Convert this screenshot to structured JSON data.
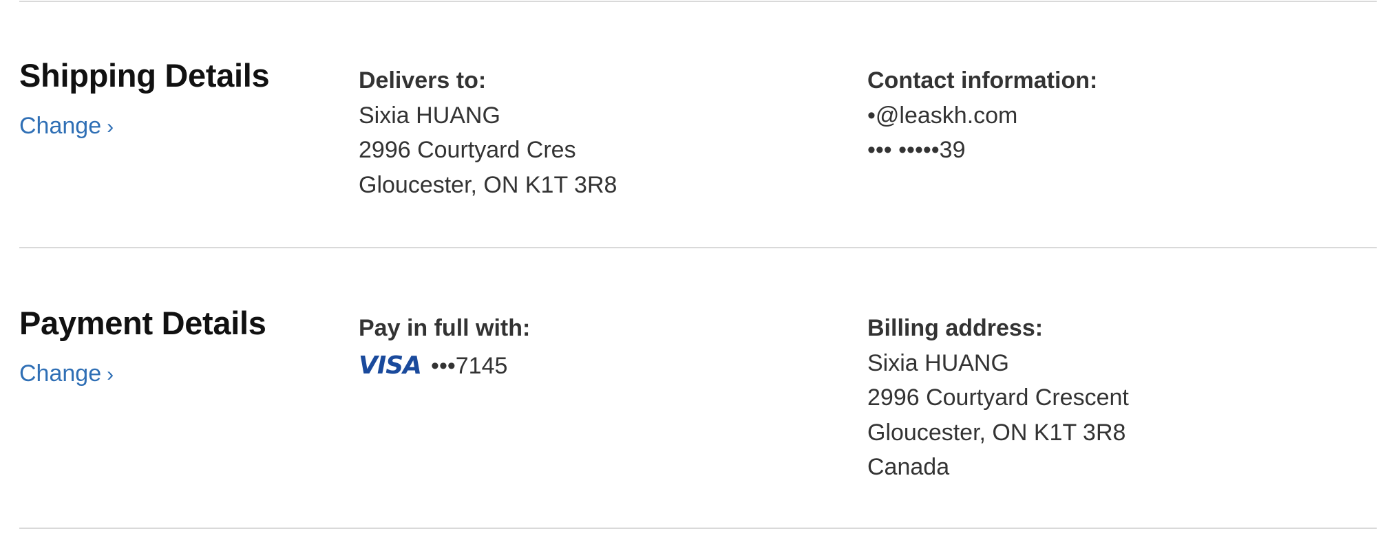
{
  "shipping": {
    "title": "Shipping Details",
    "change_label": "Change",
    "delivers_to": {
      "heading": "Delivers to:",
      "lines": [
        "Sixia HUANG",
        "2996 Courtyard Cres",
        "Gloucester, ON K1T 3R8"
      ]
    },
    "contact": {
      "heading": "Contact information:",
      "lines": [
        "•@leaskh.com",
        "••• •••••39"
      ]
    }
  },
  "payment": {
    "title": "Payment Details",
    "change_label": "Change",
    "pay_with": {
      "heading": "Pay in full with:",
      "card_brand": "VISA",
      "card_number": "•••7145"
    },
    "billing": {
      "heading": "Billing address:",
      "lines": [
        "Sixia HUANG",
        "2996 Courtyard Crescent",
        "Gloucester, ON K1T 3R8",
        "Canada"
      ]
    }
  },
  "icons": {
    "chevron": "chevron-right-icon",
    "card": "visa-logo-icon"
  },
  "colors": {
    "link": "#2f6fb5",
    "visa_blue": "#1a4a9c",
    "visa_gold": "#f2a93b"
  }
}
